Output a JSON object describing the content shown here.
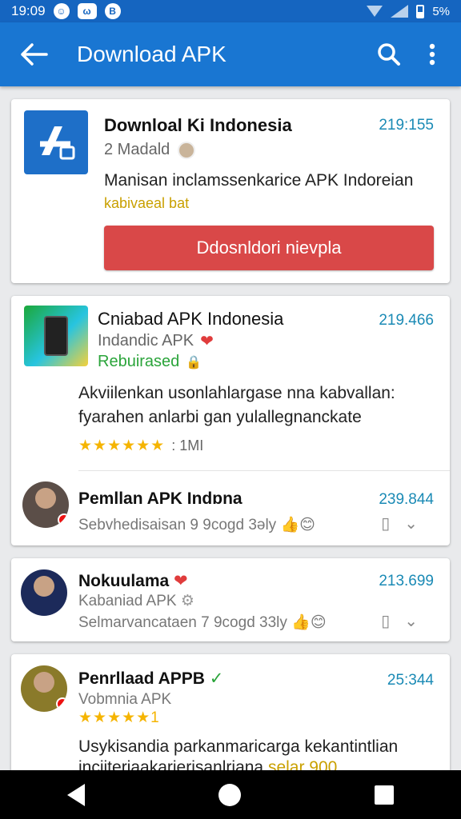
{
  "status": {
    "time": "19:09",
    "battery": "5%"
  },
  "app_bar": {
    "title": "Download APK"
  },
  "card1": {
    "title": "Downloal Ki Indonesia",
    "number": "219:155",
    "subtitle": "2 Madald",
    "description": "Manisan inclamssenkarice APK Indoreian",
    "tag": "kabivaeal bat",
    "button_label": "Ddosnldori nievpla"
  },
  "card2": {
    "title": "Cniabad APK Indonesia",
    "number": "219.466",
    "subtitle": "Indandic APK",
    "status": "Rebuirased",
    "desc1": "Akviilenkan usonlahlargase nna kabvallan:",
    "desc2": "fyarahen anlarbi gan yulallegnanckate",
    "stars": "★★★★★★",
    "count": ": 1MI",
    "row_title": "Pemllan APK Indɒna",
    "row_number": "239.844",
    "row_sub": "Sebvhedisaisan 9 9cogd 3ǝly 👍😊"
  },
  "card3": {
    "title": "Nokuulama",
    "number": "213.699",
    "subtitle": "Kabaniad APK",
    "row_sub": "Selmarvancataen 7 9cogd 33ly 👍😊"
  },
  "card4": {
    "title": "Penrllaad APPB",
    "number": "25:344",
    "subtitle": "Vobmnia APK",
    "stars": "★★★★★1",
    "desc1": "Usykisandia parkanmaricarga kekantintlian",
    "desc2": "inciiteriaakarierisanlriana",
    "desc2_highlight": "selar 900"
  }
}
